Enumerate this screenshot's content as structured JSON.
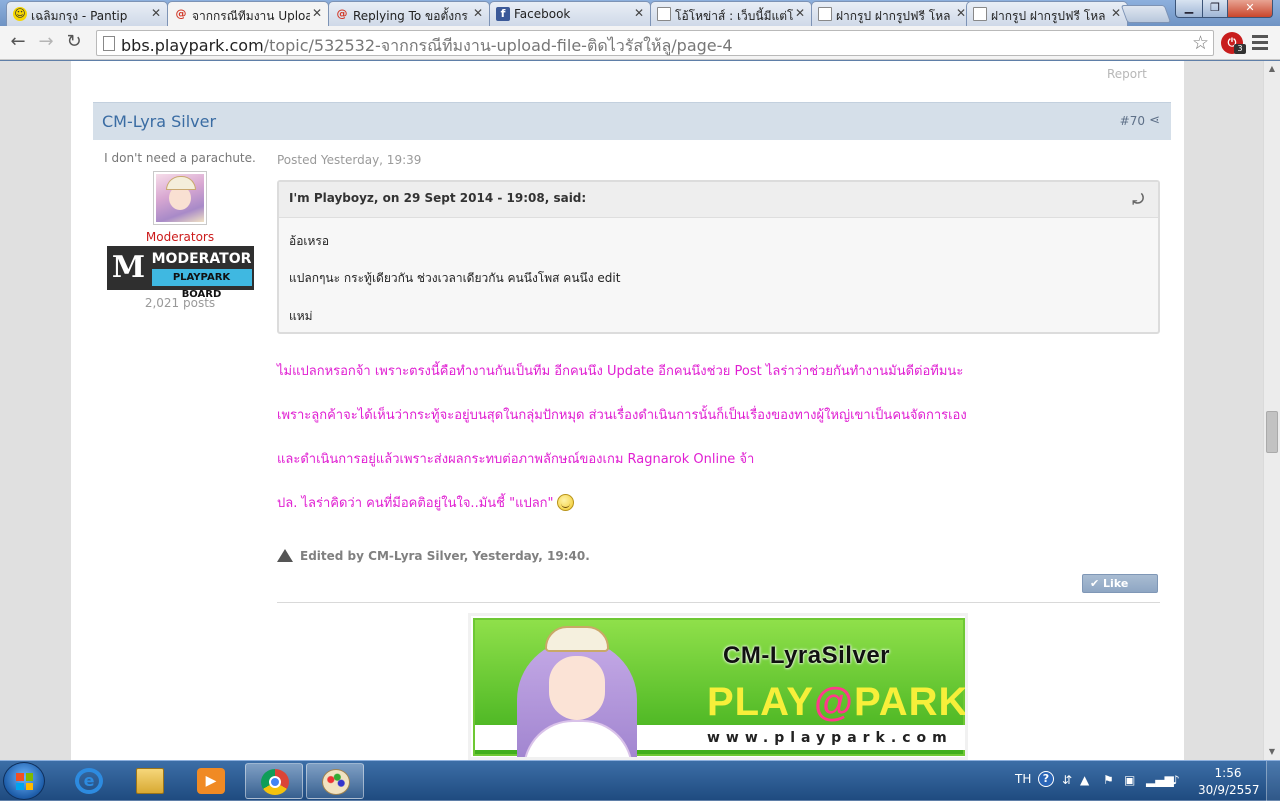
{
  "browser": {
    "tabs": [
      {
        "label": "เฉลิมกรุง - Pantip",
        "icon": "smiley-favicon",
        "active": false
      },
      {
        "label": "จากกรณีทีมงาน Uploa",
        "icon": "playpark-favicon",
        "active": true
      },
      {
        "label": "Replying To ขอตั้งกร",
        "icon": "playpark-favicon",
        "active": false
      },
      {
        "label": "Facebook",
        "icon": "facebook-favicon",
        "active": false
      },
      {
        "label": "โอ้โหข่าส์ : เว็บนี้มีแต่โ",
        "icon": "page-favicon",
        "active": false
      },
      {
        "label": "ฝากรูป ฝากรูปฟรี โหล",
        "icon": "page-favicon",
        "active": false
      },
      {
        "label": "ฝากรูป ฝากรูปฟรี โหล",
        "icon": "page-favicon",
        "active": false
      }
    ],
    "url_host": "bbs.playpark.com",
    "url_path": "/topic/532532-จากกรณีทีมงาน-upload-file-ติดไวรัสให้ลู/page-4",
    "extension_badge": "3",
    "colors": {
      "accent": "#3a6ca3",
      "post_text": "#e01fd2",
      "moderator_red": "#cc1b1b",
      "badge_blue": "#3fb8e1"
    }
  },
  "post": {
    "report_label": "Report",
    "author": "CM-Lyra Silver",
    "post_number": "#70",
    "user_title": "I don't need a parachute.",
    "group": "Moderators",
    "badge_letter": "M",
    "badge_line1": "MODERATOR",
    "badge_line2": "PLAYPARK BOARD",
    "post_count": "2,021 posts",
    "posted": "Posted Yesterday, 19:39",
    "quote": {
      "header": "I'm Playboyz, on 29 Sept 2014 - 19:08, said:",
      "lines": [
        "อ้อเหรอ",
        "แปลกๆนะ กระทู้เดียวกัน ช่วงเวลาเดียวกัน คนนึงโพส คนนึง edit",
        "แหม่"
      ]
    },
    "body": [
      "ไม่แปลกหรอกจ้า เพราะตรงนี้คือทำงานกันเป็นทีม อีกคนนึง Update อีกคนนึงช่วย Post ไลร่าว่าช่วยกันทำงานมันดีต่อทีมนะ",
      "เพราะลูกค้าจะได้เห็นว่ากระทู้จะอยู่บนสุดในกลุ่มปักหมุด ส่วนเรื่องดำเนินการนั้นก็เป็นเรื่องของทางผู้ใหญ่เขาเป็นคนจัดการเอง",
      "และดำเนินการอยู่แล้วเพราะส่งผลกระทบต่อภาพลักษณ์ของเกม  Ragnarok Online จ้า",
      "ปล. ไลร่าคิดว่า คนที่มีอคติอยู่ในใจ..มันชี้ \"แปลก\""
    ],
    "edited": "Edited by CM-Lyra Silver, Yesterday, 19:40.",
    "like_label": "Like This",
    "signature": {
      "title": "CM-LyraSilver",
      "brand_a": "PLAY",
      "brand_at": "@",
      "brand_b": "PARK",
      "url": "www.playpark.com"
    }
  },
  "taskbar": {
    "items": [
      "internet-explorer-icon",
      "file-explorer-icon",
      "media-player-icon",
      "chrome-icon",
      "paint-icon"
    ],
    "language": "TH",
    "time": "1:56",
    "date": "30/9/2557"
  }
}
